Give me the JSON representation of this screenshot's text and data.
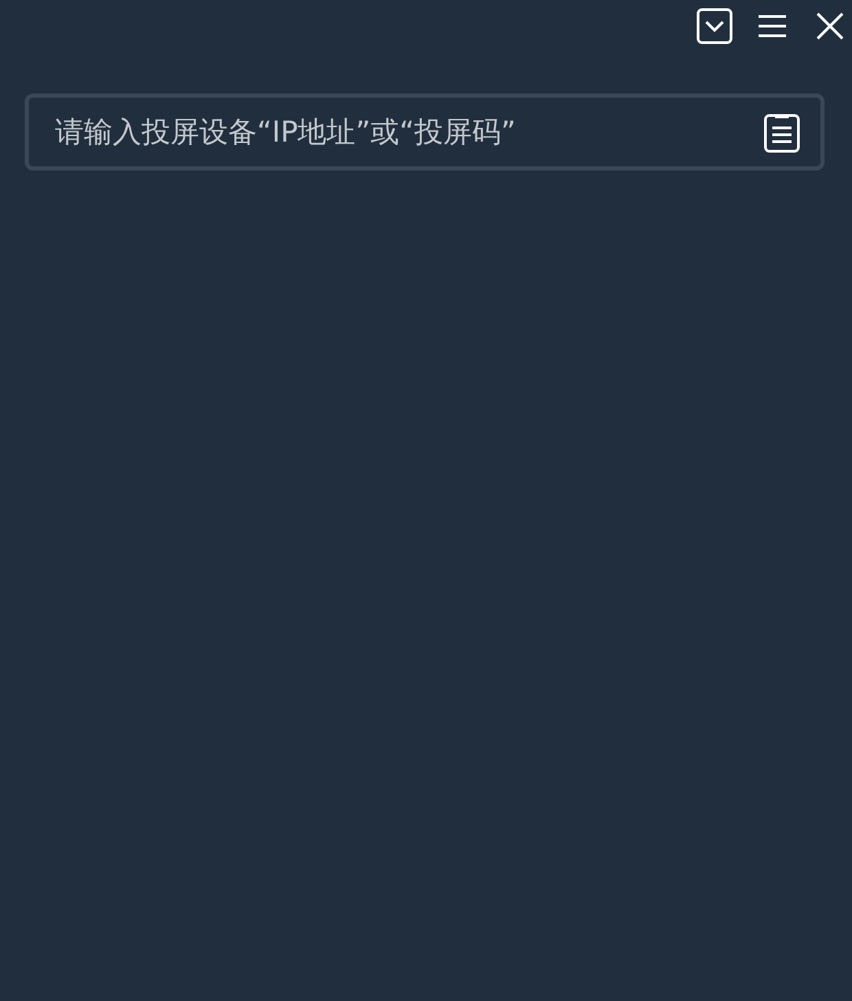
{
  "search": {
    "placeholder": "请输入投屏设备“IP地址”或“投屏码”"
  }
}
